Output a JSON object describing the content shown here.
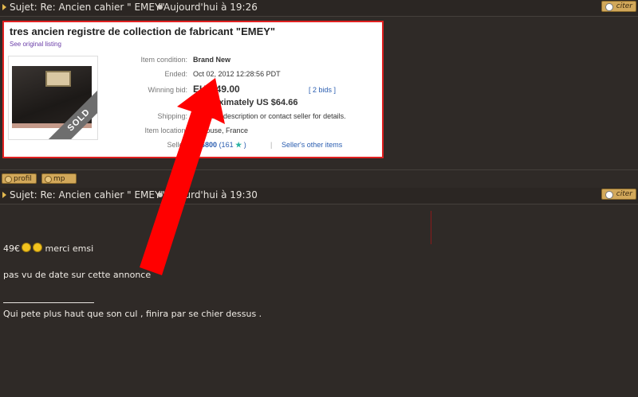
{
  "post1": {
    "subject": "Sujet: Re: Ancien cahier \" EMEY\"",
    "date": "Aujourd'hui à 19:26",
    "cite_label": "citer"
  },
  "listing": {
    "title": "tres ancien registre de collection de fabricant \"EMEY\"",
    "see_original": "See original listing",
    "sold_badge": "SOLD",
    "condition_label": "Item condition:",
    "condition_value": "Brand New",
    "ended_label": "Ended:",
    "ended_value": "Oct 02, 2012   12:28:56 PDT",
    "winning_label": "Winning bid:",
    "winning_value": "EUR 49.00",
    "bids": "[ 2 bids ]",
    "approx": "Approximately US $64.66",
    "shipping_label": "Shipping:",
    "shipping_value": "See item description or contact seller for details.",
    "location_label": "Item location:",
    "location_value": "Toulouse, France",
    "seller_label": "Seller:",
    "seller_id": "246800",
    "seller_feedback": "(161",
    "seller_feedback_close": ")",
    "seller_other": "Seller's other items"
  },
  "post1_buttons": {
    "profile": "profil",
    "pm": "mp"
  },
  "post2": {
    "subject": "Sujet: Re: Ancien cahier \" EMEY\"",
    "date": "Aujourd'hui à 19:30",
    "cite_label": "citer",
    "line1": "49€",
    "line1_end": "merci emsi",
    "line2": "pas vu de date sur cette annonce",
    "signature_rule": "_______________",
    "signature": "Qui pete plus haut que son cul , finira par se chier dessus ."
  },
  "colors": {
    "background": "#2f2a27",
    "listing_border": "#e02020",
    "arrow": "#ff0000",
    "button": "#d2a85a"
  }
}
